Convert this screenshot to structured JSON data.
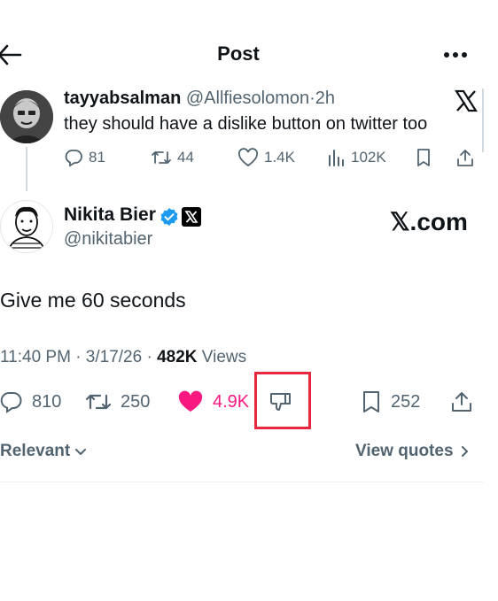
{
  "header": {
    "title": "Post"
  },
  "quoted_post": {
    "display_name": "tayyabsalman",
    "handle": "@Allfiesolomon",
    "separator": "·",
    "time": "2h",
    "text": "they should have a dislike button on twitter too",
    "actions": {
      "replies": "81",
      "reposts": "44",
      "likes": "1.4K",
      "views": "102K"
    }
  },
  "main_post": {
    "display_name": "Nikita Bier",
    "handle": "@nikitabier",
    "brand_text": "𝕏.com",
    "text": "Give me 60 seconds",
    "timestamp": "11:40 PM · 3/17/26 · ",
    "views_count": "482K",
    "views_label": " Views",
    "actions": {
      "replies": "810",
      "reposts": "250",
      "likes": "4.9K",
      "bookmarks": "252"
    }
  },
  "sort": {
    "label": "Relevant"
  },
  "view_quotes": {
    "label": "View quotes"
  },
  "colors": {
    "like_pink": "#f91880",
    "highlight_red": "#e8283e",
    "verified_blue": "#1d9bf0"
  }
}
